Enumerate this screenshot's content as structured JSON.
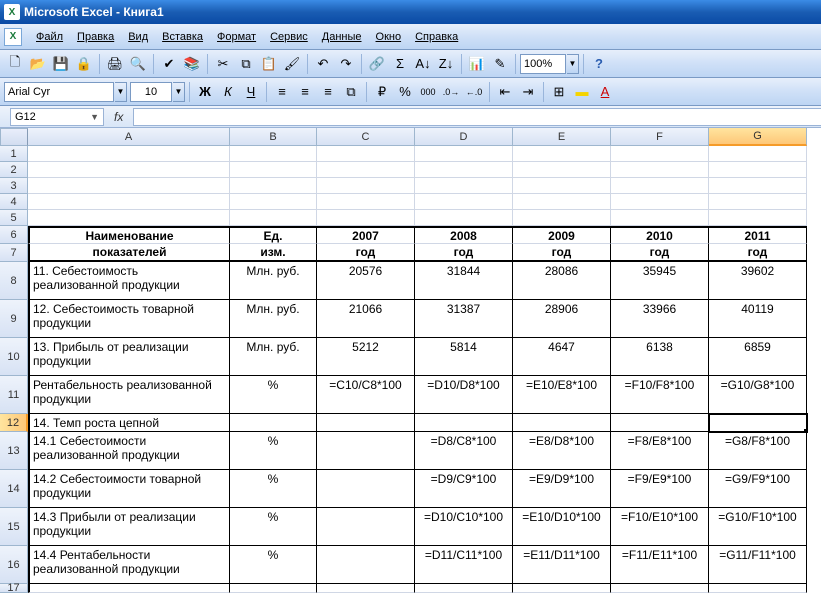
{
  "window": {
    "title": "Microsoft Excel - Книга1",
    "xl_mark": "X"
  },
  "menu": [
    "Файл",
    "Правка",
    "Вид",
    "Вставка",
    "Формат",
    "Сервис",
    "Данные",
    "Окно",
    "Справка"
  ],
  "font": {
    "name": "Arial Cyr",
    "size": "10"
  },
  "zoom": "100%",
  "namebox": "G12",
  "columns": [
    "A",
    "B",
    "C",
    "D",
    "E",
    "F",
    "G"
  ],
  "row_heights": {
    "1": 16,
    "2": 16,
    "3": 16,
    "4": 16,
    "5": 16,
    "6": 18,
    "7": 18,
    "8": 38,
    "9": 38,
    "10": 38,
    "11": 38,
    "12": 18,
    "13": 38,
    "14": 38,
    "15": 38,
    "16": 38,
    "17": 9
  },
  "selected_col": "G",
  "selected_row": 12,
  "header_rows": {
    "r6": {
      "A": "Наименование",
      "B": "Ед.",
      "C": "2007",
      "D": "2008",
      "E": "2009",
      "F": "2010",
      "G": "2011"
    },
    "r7": {
      "A": "показателей",
      "B": "изм.",
      "C": "год",
      "D": "год",
      "E": "год",
      "F": "год",
      "G": "год"
    }
  },
  "data_rows": [
    {
      "n": 8,
      "A": "11. Себестоимость реализованной продукции",
      "B": "Млн. руб.",
      "C": "20576",
      "D": "31844",
      "E": "28086",
      "F": "35945",
      "G": "39602"
    },
    {
      "n": 9,
      "A": "12. Себестоимость товарной продукции",
      "B": "Млн. руб.",
      "C": "21066",
      "D": "31387",
      "E": "28906",
      "F": "33966",
      "G": "40119"
    },
    {
      "n": 10,
      "A": "13. Прибыль от реализации продукции",
      "B": "Млн. руб.",
      "C": "5212",
      "D": "5814",
      "E": "4647",
      "F": "6138",
      "G": "6859"
    },
    {
      "n": 11,
      "A": "Рентабельность реализованной продукции",
      "B": "%",
      "C": "=C10/C8*100",
      "D": "=D10/D8*100",
      "E": "=E10/E8*100",
      "F": "=F10/F8*100",
      "G": "=G10/G8*100"
    },
    {
      "n": 12,
      "A": "14. Темп роста цепной",
      "B": "",
      "C": "",
      "D": "",
      "E": "",
      "F": "",
      "G": ""
    },
    {
      "n": 13,
      "A": "14.1 Себестоимости реализованной продукции",
      "B": "%",
      "C": "",
      "D": "=D8/C8*100",
      "E": "=E8/D8*100",
      "F": "=F8/E8*100",
      "G": "=G8/F8*100"
    },
    {
      "n": 14,
      "A": "14.2 Себестоимости товарной продукции",
      "B": "%",
      "C": "",
      "D": "=D9/C9*100",
      "E": "=E9/D9*100",
      "F": "=F9/E9*100",
      "G": "=G9/F9*100"
    },
    {
      "n": 15,
      "A": "14.3 Прибыли от реализации продукции",
      "B": "%",
      "C": "",
      "D": "=D10/C10*100",
      "E": "=E10/D10*100",
      "F": "=F10/E10*100",
      "G": "=G10/F10*100"
    },
    {
      "n": 16,
      "A": "14.4 Рентабельности реализованной продукции",
      "B": "%",
      "C": "",
      "D": "=D11/C11*100",
      "E": "=E11/D11*100",
      "F": "=F11/E11*100",
      "G": "=G11/F11*100"
    }
  ],
  "icons": {
    "new": "🗋",
    "open": "📂",
    "save": "💾",
    "perm": "🔒",
    "print": "🖨",
    "preview": "🔍",
    "spell": "✔",
    "research": "📚",
    "cut": "✂",
    "copy": "⧉",
    "paste": "📋",
    "painter": "🖌",
    "undo": "↶",
    "redo": "↷",
    "link": "🔗",
    "sum": "Σ",
    "sortaz": "A↓",
    "sortza": "Z↓",
    "chart": "📊",
    "drawing": "✎",
    "help": "?",
    "bold": "Ж",
    "italic": "К",
    "uline": "Ч",
    "alignl": "≡",
    "alignc": "≡",
    "alignr": "≡",
    "merge": "⧉",
    "currency": "₽",
    "percent": "%",
    "comma": "000",
    "decinc": ".0→",
    "decdec": "←.0",
    "indentl": "⇤",
    "indentr": "⇥",
    "borders": "⊞",
    "fill": "▬",
    "fontcolor": "A"
  }
}
